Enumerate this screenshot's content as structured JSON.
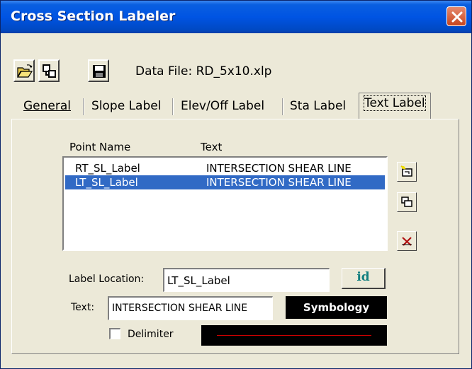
{
  "window": {
    "title": "Cross Section Labeler"
  },
  "toolbar": {
    "open_icon": "open-folder-icon",
    "new_icon": "copy-structure-icon",
    "save_icon": "floppy-disk-icon",
    "data_file_label": "Data File: RD_5x10.xlp"
  },
  "tabs": [
    {
      "label": "General",
      "active": false
    },
    {
      "label": "Slope Label",
      "active": false
    },
    {
      "label": "Elev/Off Label",
      "active": false
    },
    {
      "label": "Sta Label",
      "active": false
    },
    {
      "label": "Text Label",
      "active": true
    }
  ],
  "list": {
    "columns": [
      "Point Name",
      "Text"
    ],
    "rows": [
      {
        "point": "RT_SL_Label",
        "text": "INTERSECTION SHEAR LINE",
        "selected": false
      },
      {
        "point": "LT_SL_Label",
        "text": "INTERSECTION SHEAR LINE",
        "selected": true
      }
    ]
  },
  "side_buttons": {
    "add_icon": "add-item-icon",
    "copy_icon": "duplicate-icon",
    "delete_icon": "delete-x-icon"
  },
  "form": {
    "label_location_label": "Label Location:",
    "label_location_value": "LT_SL_Label",
    "id_button": "id",
    "text_label": "Text:",
    "text_value": "INTERSECTION SHEAR LINE",
    "symbology_button": "Symbology",
    "delimiter_label": "Delimiter",
    "delimiter_checked": false
  },
  "colors": {
    "title_bar": "#0054e3",
    "selection": "#316ac5",
    "dialog_bg": "#ece9d8",
    "delimiter_line": "#d00000"
  }
}
